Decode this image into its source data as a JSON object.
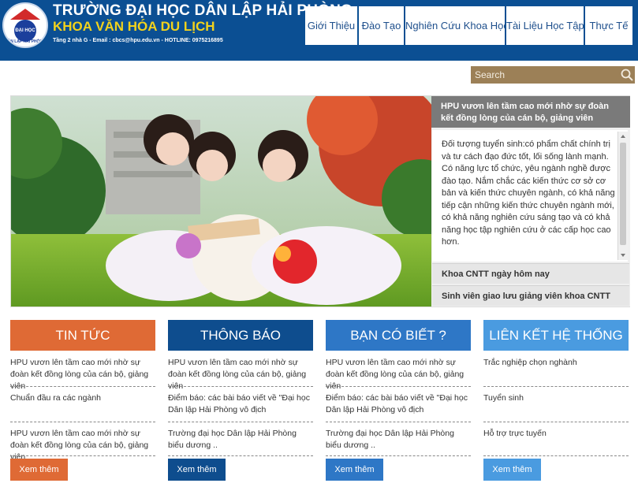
{
  "header": {
    "logo_text": "ĐẠI HỌC",
    "logo_ring": "DÂN LẬP HẢI PHÒNG",
    "school_name": "TRƯỜNG ĐẠI HỌC DÂN LẬP HẢI PHÒNG",
    "faculty_name": "KHOA VĂN HÓA DU LỊCH",
    "contact": "Tầng 2 nhà G - Email : cbcs@hpu.edu.vn - HOTLINE: 0975216895"
  },
  "nav": {
    "items": [
      {
        "label": "Giới Thiệu"
      },
      {
        "label": "Đào Tạo"
      },
      {
        "label": "Nghiên Cứu Khoa Học"
      },
      {
        "label": "Tài Liệu Học Tập"
      },
      {
        "label": "Thực Tế"
      }
    ]
  },
  "search": {
    "placeholder": "Search",
    "icon": "search-icon"
  },
  "slider": {
    "active_title": "HPU vươn lên tầm cao mới nhờ sự đoàn kết đồng lòng của cán bộ, giảng viên",
    "active_text": "Đối tượng tuyển sinh:có phẩm chất chính trị và tư cách đạo đức tốt, lối sống lành mạnh. Có năng lực tổ chức, yêu ngành nghề được đào tạo. Nắm chắc các kiến thức cơ sở cơ bản và kiến thức chuyên ngành, có khả năng tiếp cận những kiến thức chuyên ngành mới, có khả năng nghiên cứu sáng tạo và có khả năng học tập nghiên cứu ở các cấp học cao hơn.",
    "items": [
      {
        "label": "Khoa CNTT ngày hôm nay"
      },
      {
        "label": "Sinh viên giao lưu giảng viên khoa CNTT"
      }
    ]
  },
  "columns": [
    {
      "title": "TIN TỨC",
      "color": "#df6a35",
      "items": [
        "HPU vươn lên tầm cao mới nhờ sự đoàn kết đồng lòng của cán bộ, giảng viên",
        "Chuẩn đầu ra các ngành",
        "HPU vươn lên tầm cao mới nhờ sự đoàn kết đồng lòng của cán bộ, giảng viên"
      ],
      "more": "Xem thêm"
    },
    {
      "title": "THÔNG BÁO",
      "color": "#0e4d8e",
      "items": [
        "HPU vươn lên tầm cao mới nhờ sự đoàn kết đồng lòng của cán bộ, giảng viên",
        "Điểm báo: các bài báo viết về \"Đại học Dân lập Hải Phòng vô địch",
        "Trường đại học Dân lập Hải Phòng biểu dương .."
      ],
      "more": "Xem thêm"
    },
    {
      "title": "BẠN CÓ BIẾT ?",
      "color": "#2e77c6",
      "items": [
        "HPU vươn lên tầm cao mới nhờ sự đoàn kết đồng lòng của cán bộ, giảng viên",
        "Điểm báo: các bài báo viết về \"Đại học Dân lập Hải Phòng vô địch",
        "Trường đại học Dân lập Hải Phòng biểu dương .."
      ],
      "more": "Xem thêm"
    },
    {
      "title": "LIÊN KẾT HỆ THỐNG",
      "color": "#4a9be0",
      "items": [
        "Trắc nghiệp chọn nghành",
        "Tuyển sinh",
        "Hỗ trợ trực tuyến"
      ],
      "more": "Xem thêm"
    }
  ],
  "colors": {
    "header_blue": "#0b4f93",
    "faculty_yellow": "#f2d21c",
    "search_bg": "#9c8057",
    "panel_head": "#7a7a7a"
  }
}
